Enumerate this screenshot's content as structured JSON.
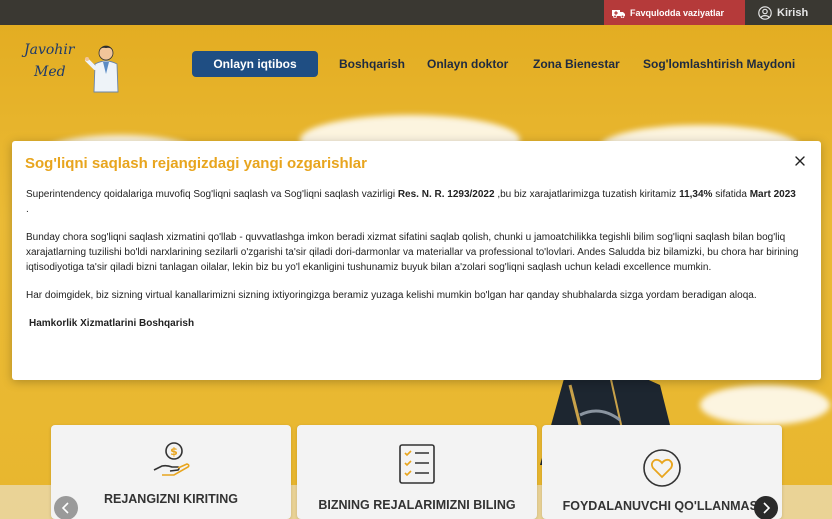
{
  "topbar": {
    "emergency_label": "Favqulodda vaziyatlar",
    "login_label": "Kirish"
  },
  "logo": {
    "line1": "Javohir",
    "line2": "Med"
  },
  "nav": {
    "primary_button": "Onlayn iqtibos",
    "items": [
      "Boshqarish",
      "Onlayn doktor",
      "Zona Bienestar",
      "Sog'lomlashtirish Maydoni"
    ]
  },
  "modal": {
    "title": "Sog'liqni saqlash rejangizdagi yangi ozgarishlar",
    "p1_a": "Superintendency qoidalariga muvofiq Sog'liqni saqlash va Sog'liqni saqlash vazirligi ",
    "p1_res": "Res. N. R. 1293/2022",
    "p1_b": " ,bu biz xarajatlarimizga tuzatish kiritamiz ",
    "p1_pct": "11,34%",
    "p1_c": " sifatida ",
    "p1_date": "Mart 2023",
    "p1_d": " .",
    "p2": "Bunday chora sog'liqni saqlash xizmatini qo'llab - quvvatlashga imkon beradi xizmat sifatini saqlab qolish, chunki u jamoatchilikka tegishli bilim sog'liqni saqlash bilan bog'liq xarajatlarning tuzilishi bo'ldi narxlarining sezilarli o'zgarishi ta'sir qiladi dori-darmonlar va materiallar va professional to'lovlari. Andes Saludda biz bilamizki, bu chora har birining iqtisodiyotiga ta'sir qiladi bizni tanlagan oilalar, lekin biz bu yo'l ekanligini tushunamiz buyuk bilan a'zolari sog'liqni saqlash uchun keladi excellence mumkin.",
    "p3": "Har doimgidek, biz sizning virtual kanallarimizni sizning ixtiyoringizga beramiz yuzaga kelishi mumkin bo'lgan har qanday shubhalarda sizga yordam beradigan aloqa.",
    "signature": "Hamkorlik Xizmatlarini Boshqarish"
  },
  "cards": [
    {
      "label": "REJANGIZNI KIRITING",
      "icon": "money-hand-icon"
    },
    {
      "label": "BIZNING REJALARIMIZNI BILING",
      "icon": "checklist-icon"
    },
    {
      "label": "FOYDALANUVCHI QO'LLANMASI",
      "icon": "heart-icon"
    }
  ],
  "colors": {
    "accent": "#e8a51e",
    "nav_button": "#1f4e83",
    "emergency": "#b53a3a",
    "topbar": "#3a3832",
    "hero": "#e8b62e"
  }
}
